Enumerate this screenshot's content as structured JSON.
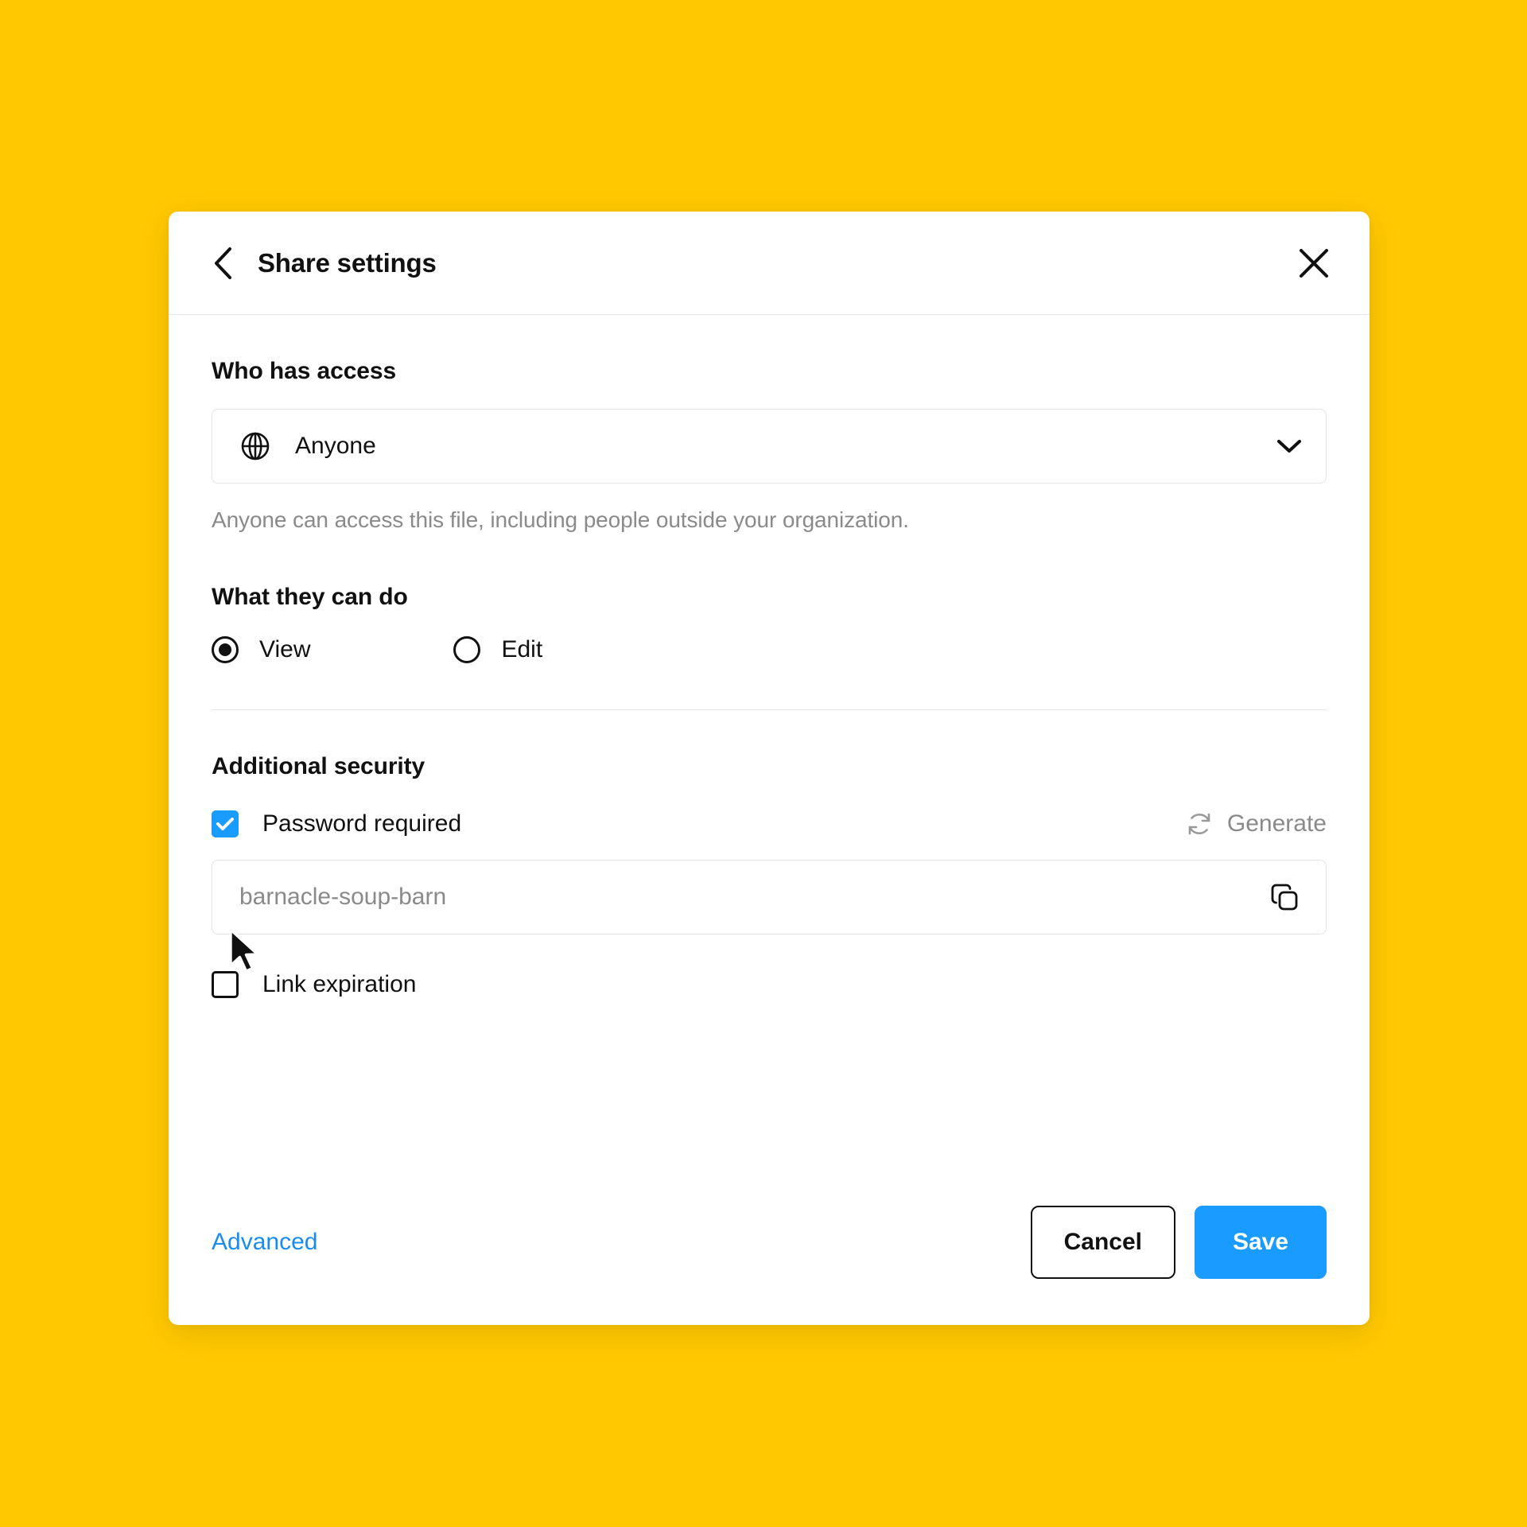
{
  "background_color": "#FFC800",
  "accent_color": "#1A9BFF",
  "link_color": "#1A8CF0",
  "header": {
    "title": "Share settings",
    "back_icon": "chevron-left-icon",
    "close_icon": "close-icon"
  },
  "access": {
    "label": "Who has access",
    "select_icon": "globe-icon",
    "selected_value": "Anyone",
    "chevron_icon": "chevron-down-icon",
    "helper_text": "Anyone can access this file, including people outside your organization."
  },
  "permissions": {
    "label": "What they can do",
    "options": [
      {
        "label": "View",
        "selected": true
      },
      {
        "label": "Edit",
        "selected": false
      }
    ]
  },
  "security": {
    "label": "Additional security",
    "password_required": {
      "label": "Password required",
      "checked": true
    },
    "generate": {
      "label": "Generate",
      "icon": "refresh-icon"
    },
    "password_field": {
      "value": "barnacle-soup-barn",
      "placeholder": "barnacle-soup-barn",
      "copy_icon": "copy-icon"
    },
    "link_expiration": {
      "label": "Link expiration",
      "checked": false
    }
  },
  "footer": {
    "advanced_label": "Advanced",
    "cancel_label": "Cancel",
    "save_label": "Save"
  },
  "cursor": {
    "icon": "mouse-pointer-icon"
  }
}
